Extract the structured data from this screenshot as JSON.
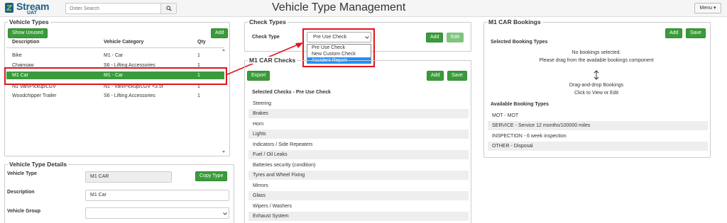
{
  "header": {
    "logo_text": "Stream",
    "logo_sub": "UAT",
    "search_placeholder": "Order Search",
    "title": "Vehicle Type Management",
    "menu_label": "Menu ▾"
  },
  "vehicle_types": {
    "legend": "Vehicle Types",
    "show_unused": "Show Unused",
    "add": "Add",
    "columns": [
      "Description",
      "Vehicle Category",
      "Qty"
    ],
    "rows": [
      {
        "description": "Bike",
        "category": "M1 - Car",
        "qty": "1"
      },
      {
        "description": "Chainsaw",
        "category": "S6 - Lifting Accessories",
        "qty": "1"
      },
      {
        "description": "M1 Car",
        "category": "M1 - Car",
        "qty": "1"
      },
      {
        "description": "N1 Van/Pickup/LGV",
        "category": "N1 - Van/Pickup/LGV <3.5t",
        "qty": "1"
      },
      {
        "description": "Woodchipper Trailer",
        "category": "S6 - Lifting Accessories",
        "qty": "1"
      }
    ]
  },
  "details": {
    "legend": "Vehicle Type Details",
    "vehicle_type_label": "Vehicle Type",
    "vehicle_type_value": "M1 CAR",
    "copy_type": "Copy Type",
    "description_label": "Description",
    "description_value": "M1 Car",
    "vehicle_group_label": "Vehicle Group",
    "vehicle_group_value": ""
  },
  "check_types": {
    "legend": "Check Types",
    "label": "Check Type",
    "selected": "Pre Use Check",
    "options": [
      "Pre Use Check",
      "New Custom Check",
      "Accident Report"
    ],
    "add": "Add",
    "edit": "Edit"
  },
  "m1_checks": {
    "legend": "M1 CAR Checks",
    "export": "Export",
    "add": "Add",
    "save": "Save",
    "section_title": "Selected Checks - Pre Use Check",
    "items": [
      "Steering",
      "Brakes",
      "Horn",
      "Lights",
      "Indicators / Side Repeaters",
      "Fuel / Oil Leaks",
      "Batteries security (condition)",
      "Tyres and Wheel Fixing",
      "Mirrors",
      "Glass",
      "Wipers / Washers",
      "Exhaust System"
    ]
  },
  "bookings": {
    "legend": "M1 CAR Bookings",
    "add": "Add",
    "save": "Save",
    "selected_title": "Selected Booking Types",
    "empty_line1": "No bookings selected.",
    "empty_line2": "Please drag from the available bookings component",
    "drag_line1": "Drag-and-drop Bookings",
    "drag_line2": "Click to View or Edit",
    "available_title": "Available Booking Types",
    "available": [
      "MOT - MOT",
      "SERVICE - Service 12 months/100000 miles",
      "INSPECTION - 6 week inspection",
      "OTHER - Disposal"
    ]
  },
  "colors": {
    "accent_green": "#3b9b3b",
    "highlight_red": "#e0141e",
    "dropdown_highlight": "#1e90ff",
    "brand_blue": "#1f5c83"
  }
}
